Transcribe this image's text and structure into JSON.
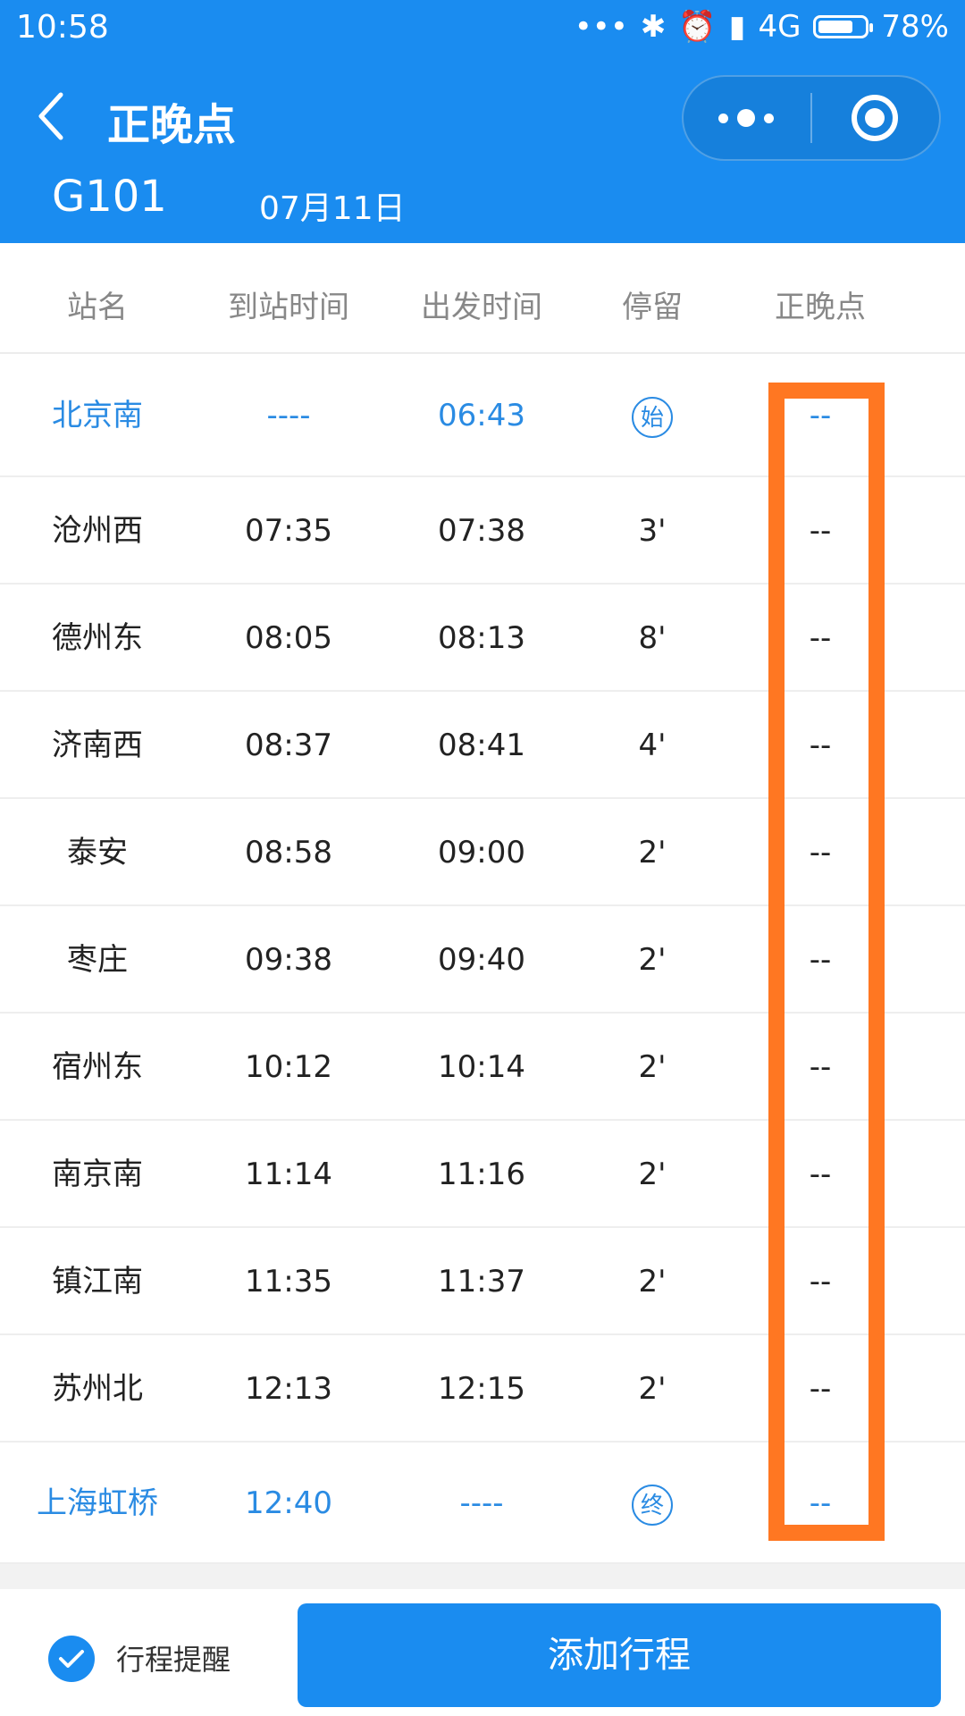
{
  "status_bar": {
    "time": "10:58",
    "signal_text": "4G",
    "battery": "78%",
    "battery_level": 0.78
  },
  "header": {
    "title": "正晚点",
    "train": "G101",
    "date": "07月11日"
  },
  "colors": {
    "accent": "#1a8cf0",
    "highlight": "#ff7722",
    "blue_text": "#2a8be3"
  },
  "table": {
    "columns": [
      "站名",
      "到站时间",
      "出发时间",
      "停留",
      "正晚点"
    ],
    "rows": [
      {
        "station": "北京南",
        "arrive": "----",
        "depart": "06:43",
        "stop": "始",
        "status": "--"
      },
      {
        "station": "沧州西",
        "arrive": "07:35",
        "depart": "07:38",
        "stop": "3'",
        "status": "--"
      },
      {
        "station": "德州东",
        "arrive": "08:05",
        "depart": "08:13",
        "stop": "8'",
        "status": "--"
      },
      {
        "station": "济南西",
        "arrive": "08:37",
        "depart": "08:41",
        "stop": "4'",
        "status": "--"
      },
      {
        "station": "泰安",
        "arrive": "08:58",
        "depart": "09:00",
        "stop": "2'",
        "status": "--"
      },
      {
        "station": "枣庄",
        "arrive": "09:38",
        "depart": "09:40",
        "stop": "2'",
        "status": "--"
      },
      {
        "station": "宿州东",
        "arrive": "10:12",
        "depart": "10:14",
        "stop": "2'",
        "status": "--"
      },
      {
        "station": "南京南",
        "arrive": "11:14",
        "depart": "11:16",
        "stop": "2'",
        "status": "--"
      },
      {
        "station": "镇江南",
        "arrive": "11:35",
        "depart": "11:37",
        "stop": "2'",
        "status": "--"
      },
      {
        "station": "苏州北",
        "arrive": "12:13",
        "depart": "12:15",
        "stop": "2'",
        "status": "--"
      },
      {
        "station": "上海虹桥",
        "arrive": "12:40",
        "depart": "----",
        "stop": "终",
        "status": "--"
      }
    ]
  },
  "footer": {
    "remind_label": "行程提醒",
    "add_label": "添加行程"
  }
}
